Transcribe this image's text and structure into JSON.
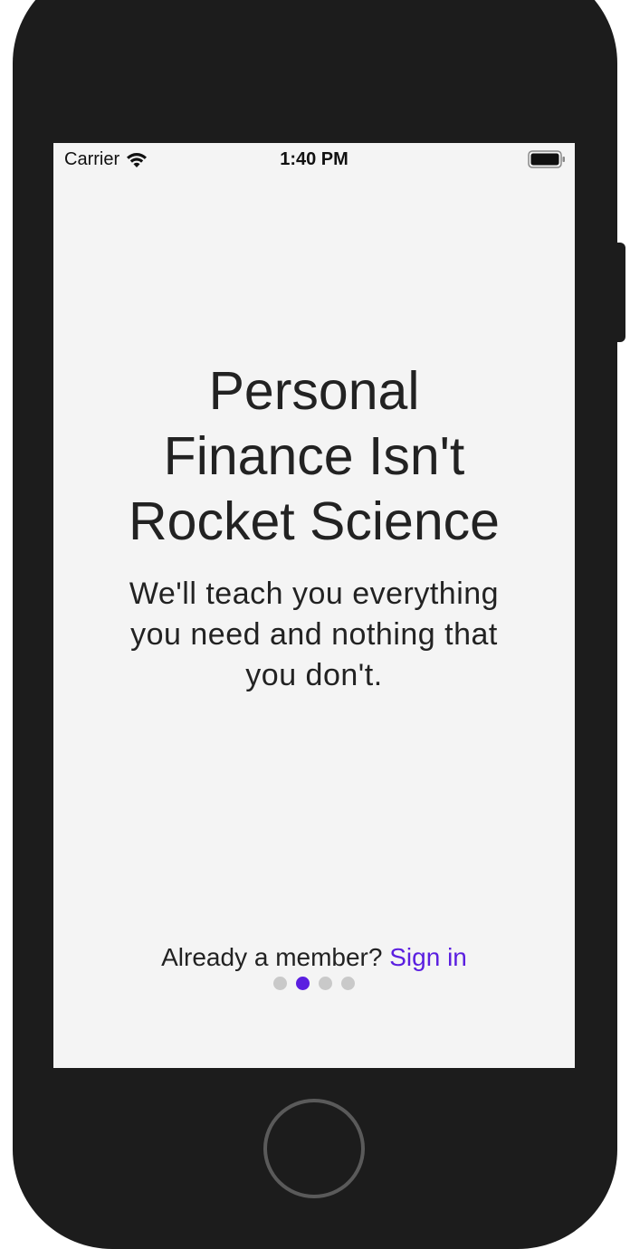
{
  "status_bar": {
    "carrier": "Carrier",
    "time": "1:40 PM",
    "wifi_icon": "wifi-icon",
    "battery_icon": "battery-full-icon"
  },
  "onboarding": {
    "headline_lines": [
      "Personal",
      "Finance Isn't",
      "Rocket Science"
    ],
    "subtitle_lines": [
      "We'll teach you everything",
      "you need and nothing that",
      "you don't."
    ],
    "already_member": "Already a member?",
    "sign_in": "Sign in",
    "page_count": 4,
    "current_page": 2
  },
  "colors": {
    "accent": "#5b1fe0",
    "screen_background": "#f4f4f4",
    "device_frame": "#1c1c1c",
    "dot_inactive": "#c9c9c9"
  }
}
